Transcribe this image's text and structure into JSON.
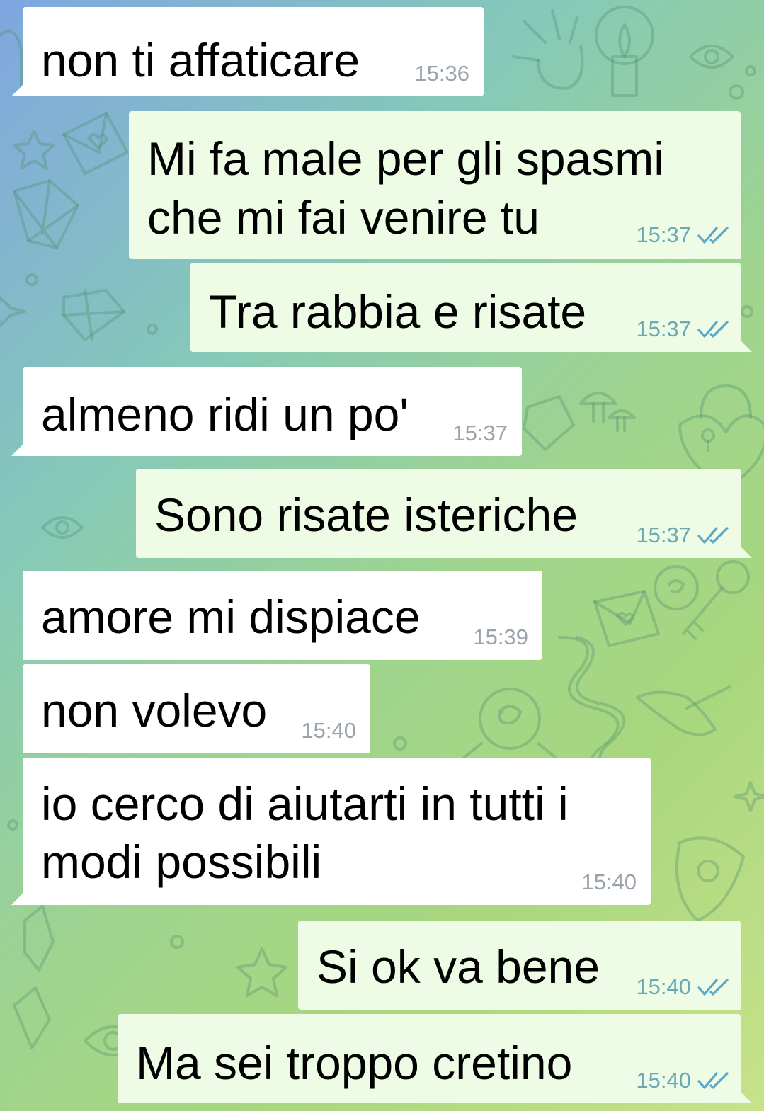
{
  "messages": [
    {
      "id": "m1",
      "direction": "incoming",
      "lines": [
        "non ti affaticare"
      ],
      "time": "15:36"
    },
    {
      "id": "m2",
      "direction": "outgoing",
      "lines": [
        "Mi fa male per gli spasmi",
        "che mi fai venire tu"
      ],
      "time": "15:37",
      "status": "read-double-check-icon"
    },
    {
      "id": "m3",
      "direction": "outgoing",
      "lines": [
        "Tra rabbia e risate"
      ],
      "time": "15:37",
      "status": "read-double-check-icon"
    },
    {
      "id": "m4",
      "direction": "incoming",
      "lines": [
        "almeno ridi un po'"
      ],
      "time": "15:37"
    },
    {
      "id": "m5",
      "direction": "outgoing",
      "lines": [
        "Sono risate isteriche"
      ],
      "time": "15:37",
      "status": "read-double-check-icon"
    },
    {
      "id": "m6",
      "direction": "incoming",
      "lines": [
        "amore mi dispiace"
      ],
      "time": "15:39"
    },
    {
      "id": "m7",
      "direction": "incoming",
      "lines": [
        "non volevo"
      ],
      "time": "15:40"
    },
    {
      "id": "m8",
      "direction": "incoming",
      "lines": [
        "io cerco di aiutarti in tutti i",
        "modi possibili"
      ],
      "time": "15:40"
    },
    {
      "id": "m9",
      "direction": "outgoing",
      "lines": [
        "Si ok va bene"
      ],
      "time": "15:40",
      "status": "read-double-check-icon"
    },
    {
      "id": "m10",
      "direction": "outgoing",
      "lines": [
        "Ma sei troppo cretino"
      ],
      "time": "15:40",
      "status": "read-double-check-icon"
    }
  ],
  "colors": {
    "incoming_bubble": "#ffffff",
    "outgoing_bubble": "#eefbe5",
    "incoming_time": "#9aa3ab",
    "outgoing_time": "#6aa8b5",
    "read_check": "#5aa7c9"
  },
  "background": {
    "style": "telegram-doodle-wallpaper",
    "icons": [
      "crystal-icon",
      "envelope-icon",
      "eye-icon",
      "candle-icon",
      "key-icon",
      "padlock-heart-icon",
      "mushroom-icon",
      "snake-icon",
      "rose-icon",
      "hand-icon",
      "star-icon"
    ]
  }
}
